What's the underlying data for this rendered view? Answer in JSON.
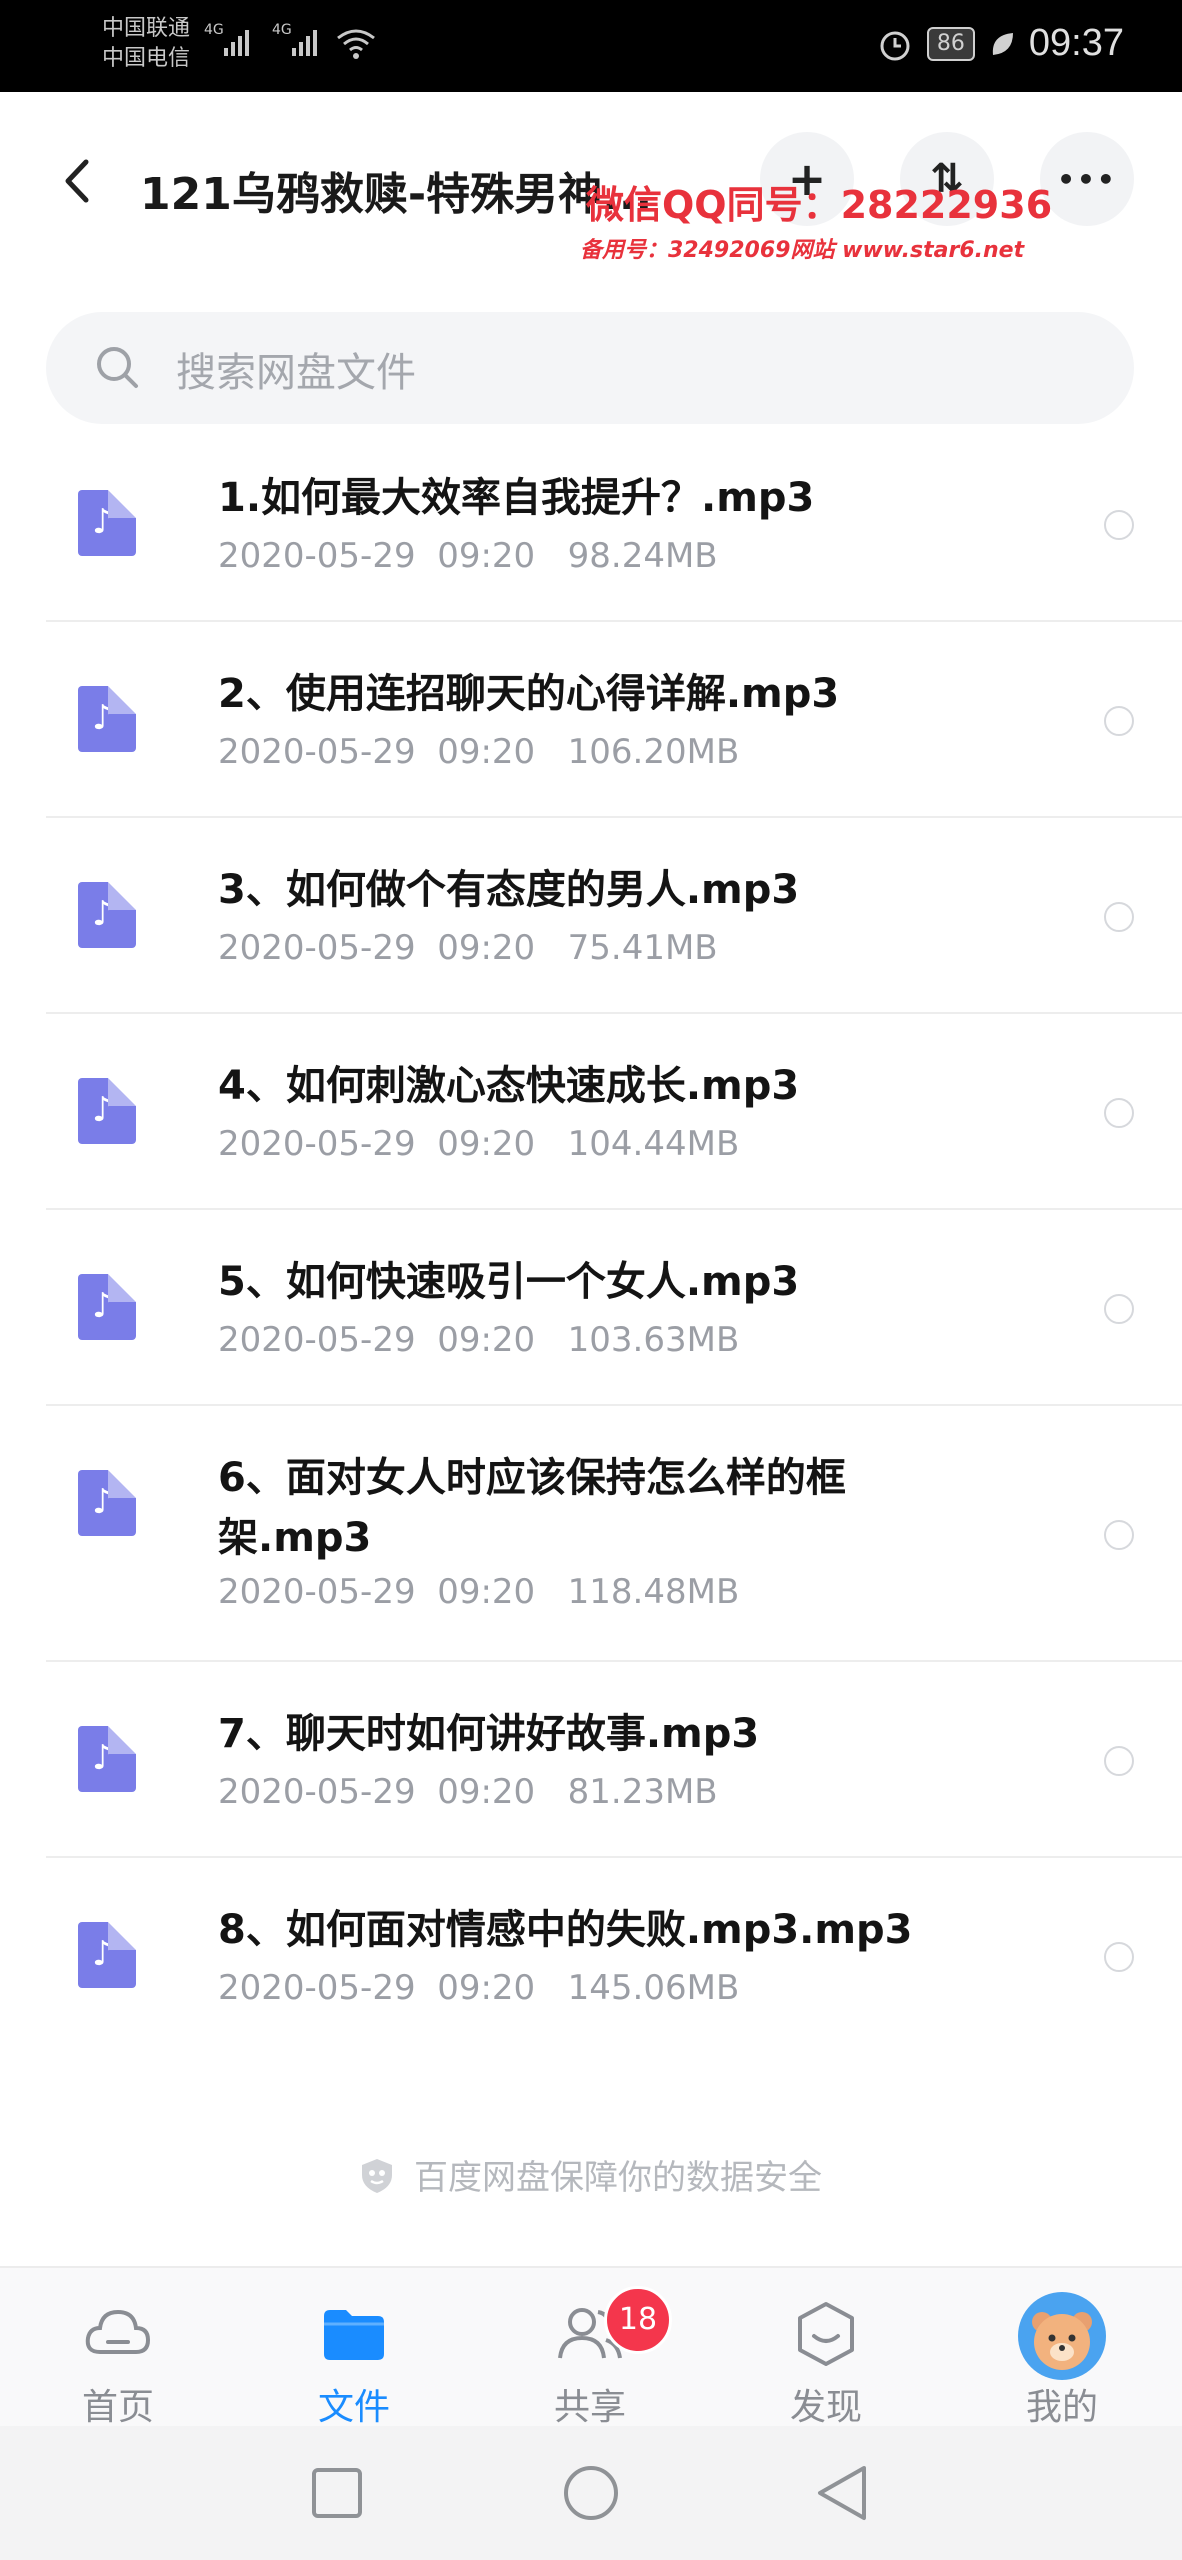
{
  "status_bar": {
    "carrier1": "中国联通",
    "carrier2": "中国电信",
    "network1": "4G",
    "network2": "4G",
    "battery": "86",
    "time": "09:37"
  },
  "header": {
    "title": "121乌鸦救赎-特殊男神...",
    "add_label": "+",
    "sort_label": "⇅",
    "more_label": "•••",
    "watermark_line1": "微信QQ同号：28222936",
    "watermark_line2": "备用号：32492069网站 www.star6.net"
  },
  "search": {
    "placeholder": "搜索网盘文件"
  },
  "files": [
    {
      "name": "1.如何最大效率自我提升？.mp3",
      "date": "2020-05-29  09:20",
      "size": "98.24MB"
    },
    {
      "name": "2、使用连招聊天的心得详解.mp3",
      "date": "2020-05-29  09:20",
      "size": "106.20MB"
    },
    {
      "name": "3、如何做个有态度的男人.mp3",
      "date": "2020-05-29  09:20",
      "size": "75.41MB"
    },
    {
      "name": "4、如何刺激心态快速成长.mp3",
      "date": "2020-05-29  09:20",
      "size": "104.44MB"
    },
    {
      "name": "5、如何快速吸引一个女人.mp3",
      "date": "2020-05-29  09:20",
      "size": "103.63MB"
    },
    {
      "name": "6、面对女人时应该保持怎么样的框架.mp3",
      "date": "2020-05-29  09:20",
      "size": "118.48MB"
    },
    {
      "name": "7、聊天时如何讲好故事.mp3",
      "date": "2020-05-29  09:20",
      "size": "81.23MB"
    },
    {
      "name": "8、如何面对情感中的失败.mp3.mp3",
      "date": "2020-05-29  09:20",
      "size": "145.06MB"
    }
  ],
  "footer_note": "百度网盘保障你的数据安全",
  "bottom_nav": {
    "home": "首页",
    "files": "文件",
    "share": "共享",
    "share_badge": "18",
    "discover": "发现",
    "mine": "我的"
  },
  "colors": {
    "accent": "#1a8cff",
    "file_icon": "#7a7de8",
    "badge": "#f4364c",
    "watermark": "#e8323c"
  }
}
